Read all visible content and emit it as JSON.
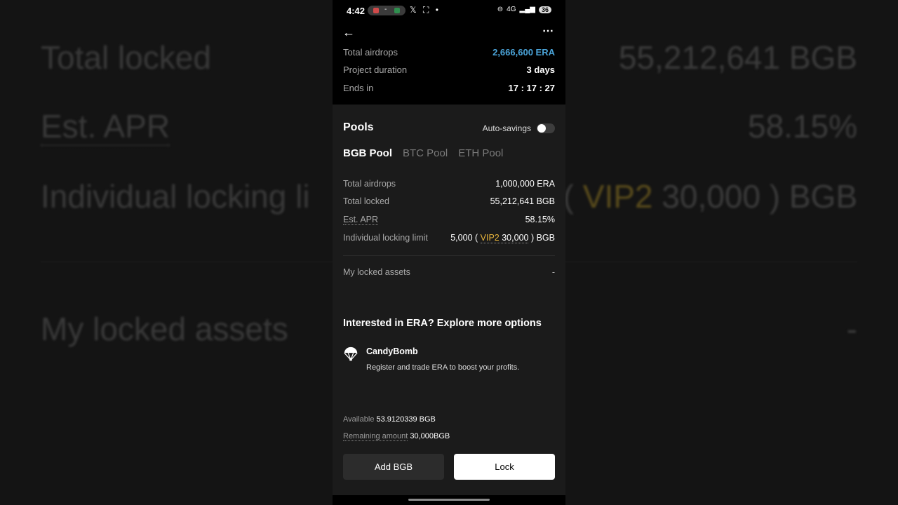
{
  "status_bar": {
    "time": "4:42",
    "pill_text": "-",
    "left_icons": "𝕏 ⛶ •",
    "network": "4G",
    "battery": "36"
  },
  "project": {
    "total_airdrops_label": "Total airdrops",
    "total_airdrops_value": "2,666,600 ERA",
    "duration_label": "Project duration",
    "duration_value": "3 days",
    "ends_label": "Ends in",
    "ends_value": "17 : 17 : 27"
  },
  "pools": {
    "title": "Pools",
    "auto_savings_label": "Auto-savings",
    "auto_savings_on": false,
    "tabs": [
      {
        "label": "BGB Pool"
      },
      {
        "label": "BTC Pool"
      },
      {
        "label": "ETH Pool"
      }
    ],
    "active_tab": "BGB Pool",
    "total_airdrops_label": "Total airdrops",
    "total_airdrops_value": "1,000,000 ERA",
    "total_locked_label": "Total locked",
    "total_locked_value": "55,212,641 BGB",
    "apr_label": "Est. APR",
    "apr_value": "58.15%",
    "limit_label": "Individual locking limit",
    "limit_base": "5,000 (",
    "limit_vip": "VIP2",
    "limit_vip_amount": "30,000",
    "limit_suffix": ") BGB",
    "my_locked_label": "My locked assets",
    "my_locked_value": "-"
  },
  "explore": {
    "title": "Interested in ERA? Explore more options",
    "item_title": "CandyBomb",
    "item_desc": "Register and trade ERA to boost your profits."
  },
  "balance": {
    "available_label": "Available",
    "available_value": "53.9120339 BGB",
    "remaining_label": "Remaining amount",
    "remaining_value": "30,000BGB"
  },
  "actions": {
    "add_label": "Add BGB",
    "lock_label": "Lock"
  },
  "background_zoom": {
    "total_locked_label": "Total locked",
    "total_locked_value": "55,212,641 BGB",
    "apr_label": "Est. APR",
    "apr_value": "58.15%",
    "limit_label": "Individual locking li",
    "limit_vip_part": "VIP2",
    "limit_tail": "30,000 ) BGB",
    "my_locked_label": "My locked assets",
    "my_locked_value": "-"
  },
  "colors": {
    "accent_blue": "#4aa3d8",
    "vip_gold": "#e7b43b",
    "card_bg": "#1b1b1b"
  }
}
